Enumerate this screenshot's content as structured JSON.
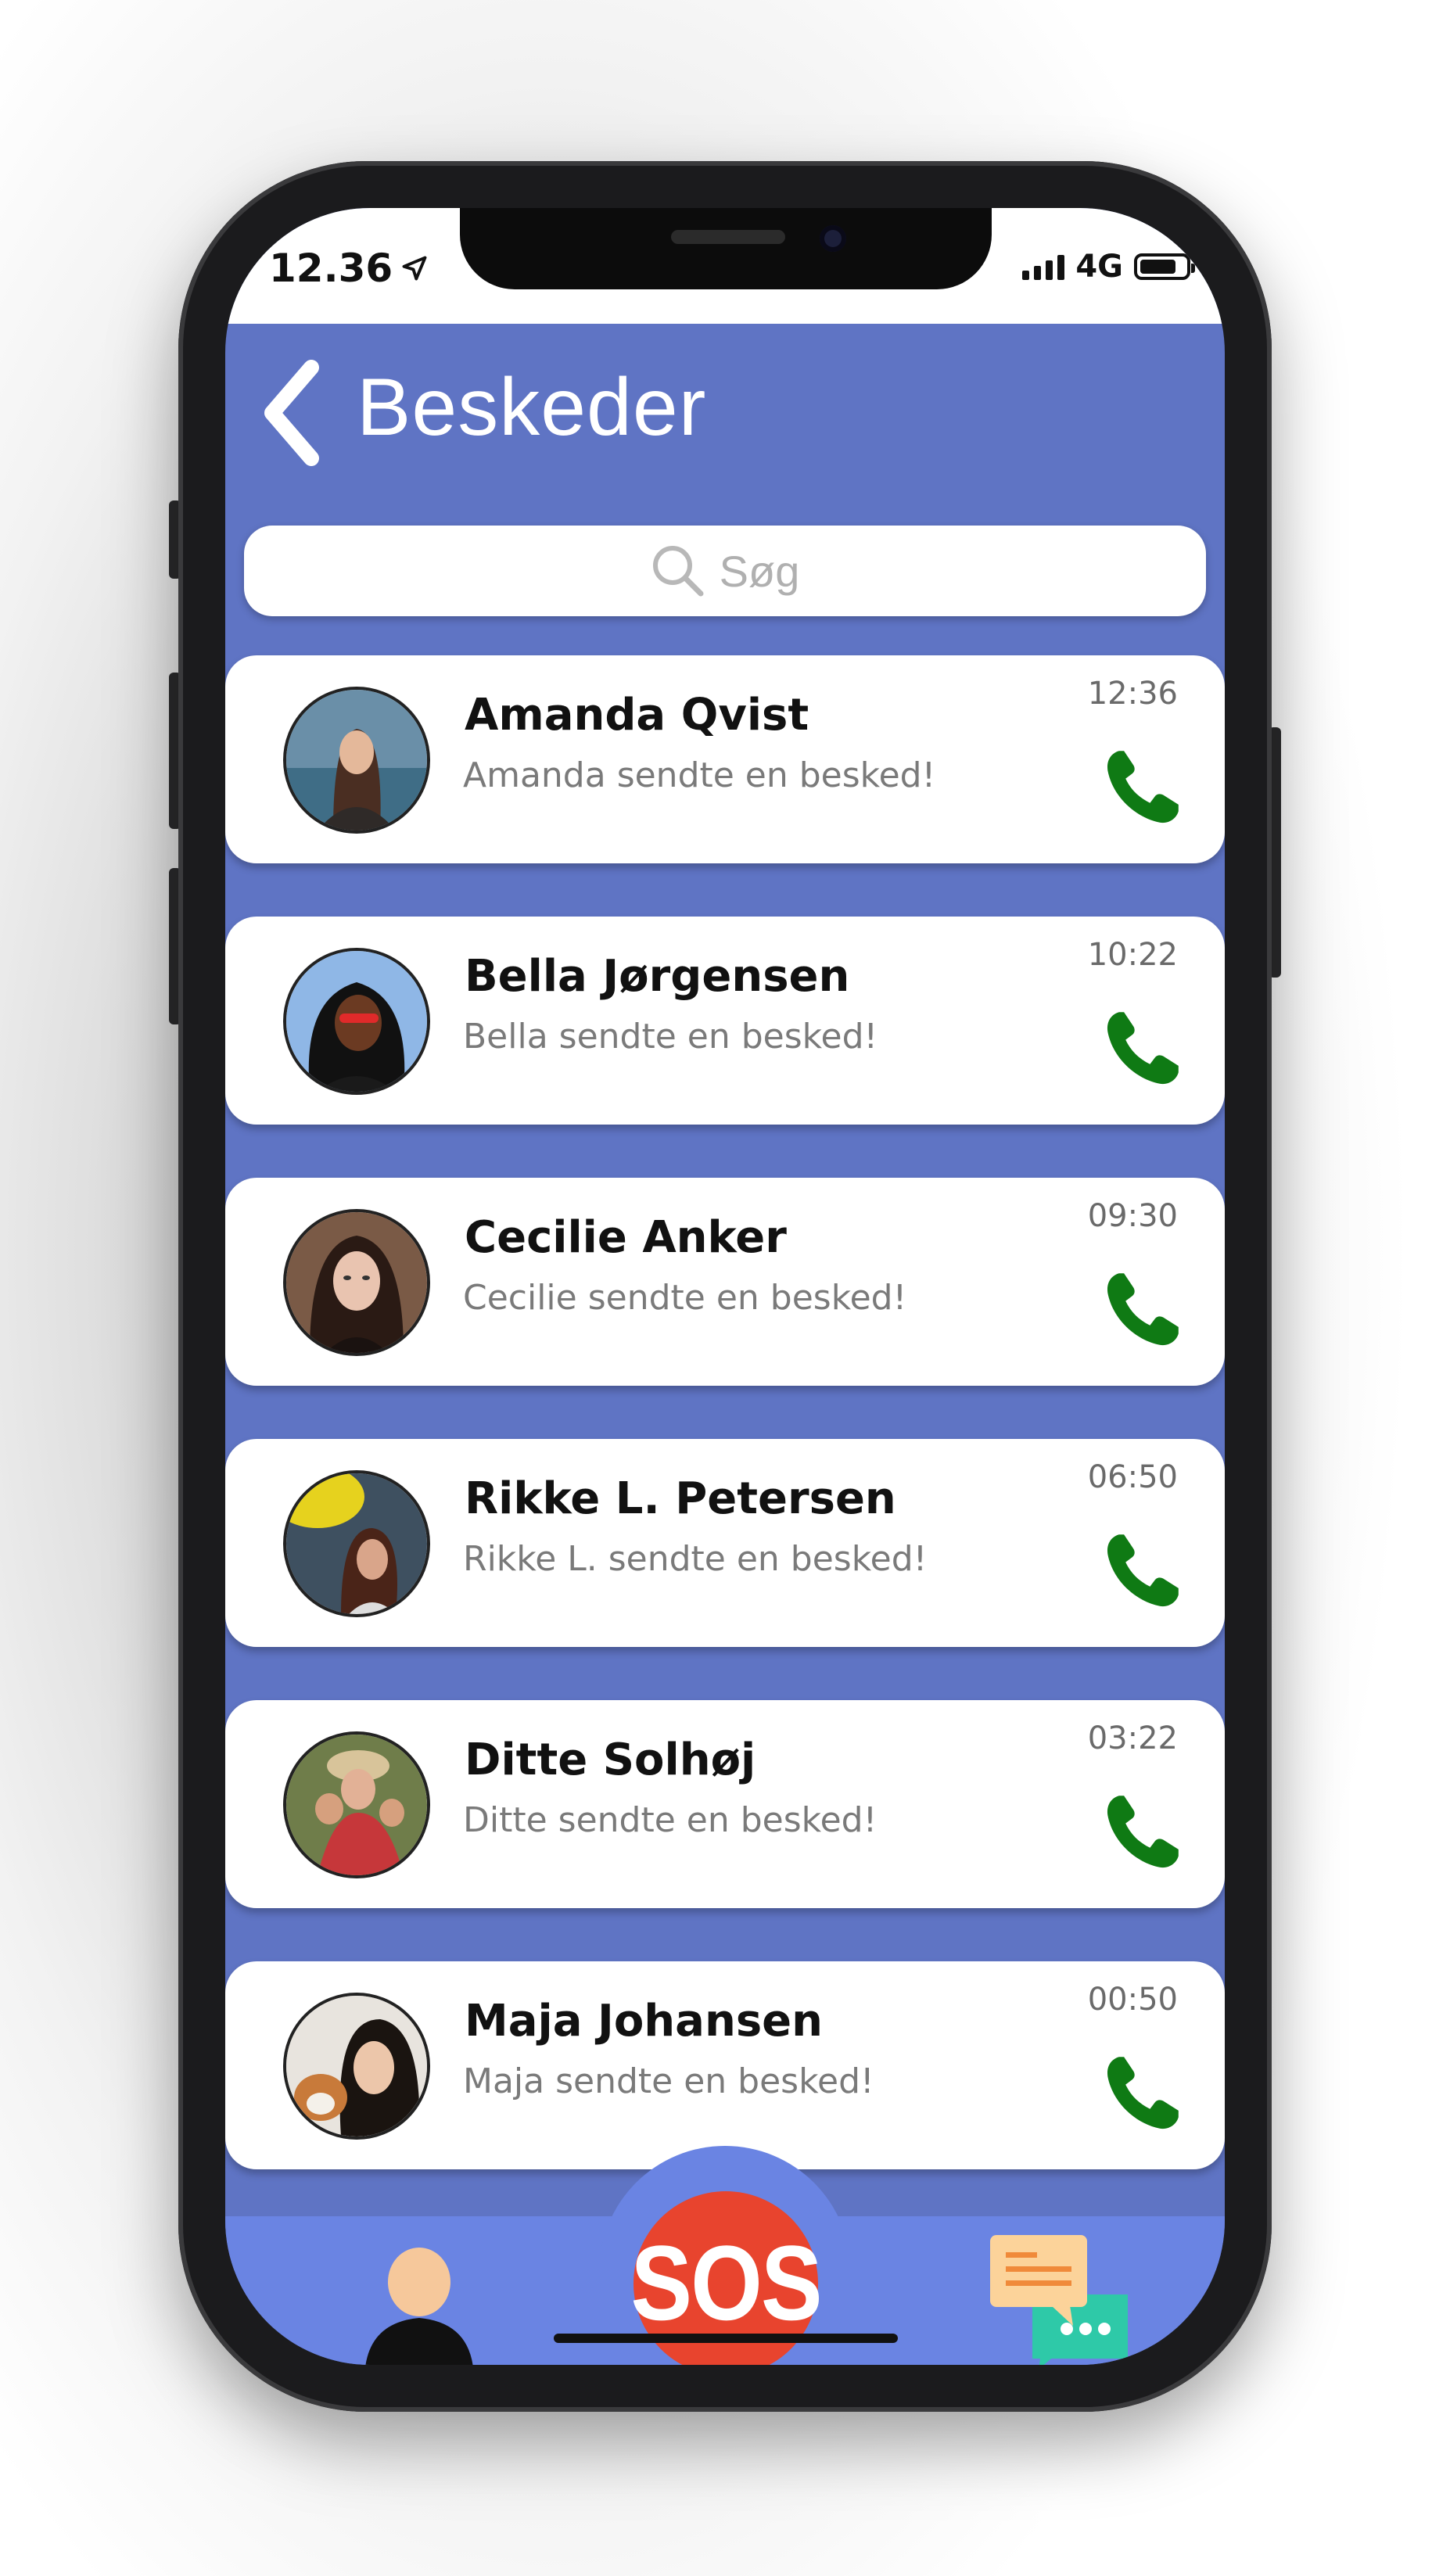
{
  "status_bar": {
    "time": "12.36",
    "network": "4G"
  },
  "header": {
    "title": "Beskeder"
  },
  "search": {
    "placeholder": "Søg"
  },
  "conversations": [
    {
      "name": "Amanda Qvist",
      "message": "Amanda sendte en besked!",
      "time": "12:36"
    },
    {
      "name": "Bella Jørgensen",
      "message": "Bella sendte en besked!",
      "time": "10:22"
    },
    {
      "name": "Cecilie Anker",
      "message": "Cecilie sendte en besked!",
      "time": "09:30"
    },
    {
      "name": "Rikke L. Petersen",
      "message": "Rikke L. sendte en besked!",
      "time": "06:50"
    },
    {
      "name": "Ditte Solhøj",
      "message": "Ditte sendte en besked!",
      "time": "03:22"
    },
    {
      "name": "Maja Johansen",
      "message": "Maja sendte en besked!",
      "time": "00:50"
    }
  ],
  "tab_bar": {
    "sos_label": "SOS"
  },
  "colors": {
    "background": "#5f74c4",
    "tab_bar": "#6a84e3",
    "sos": "#e8442e",
    "call_icon": "#0f7a14"
  }
}
